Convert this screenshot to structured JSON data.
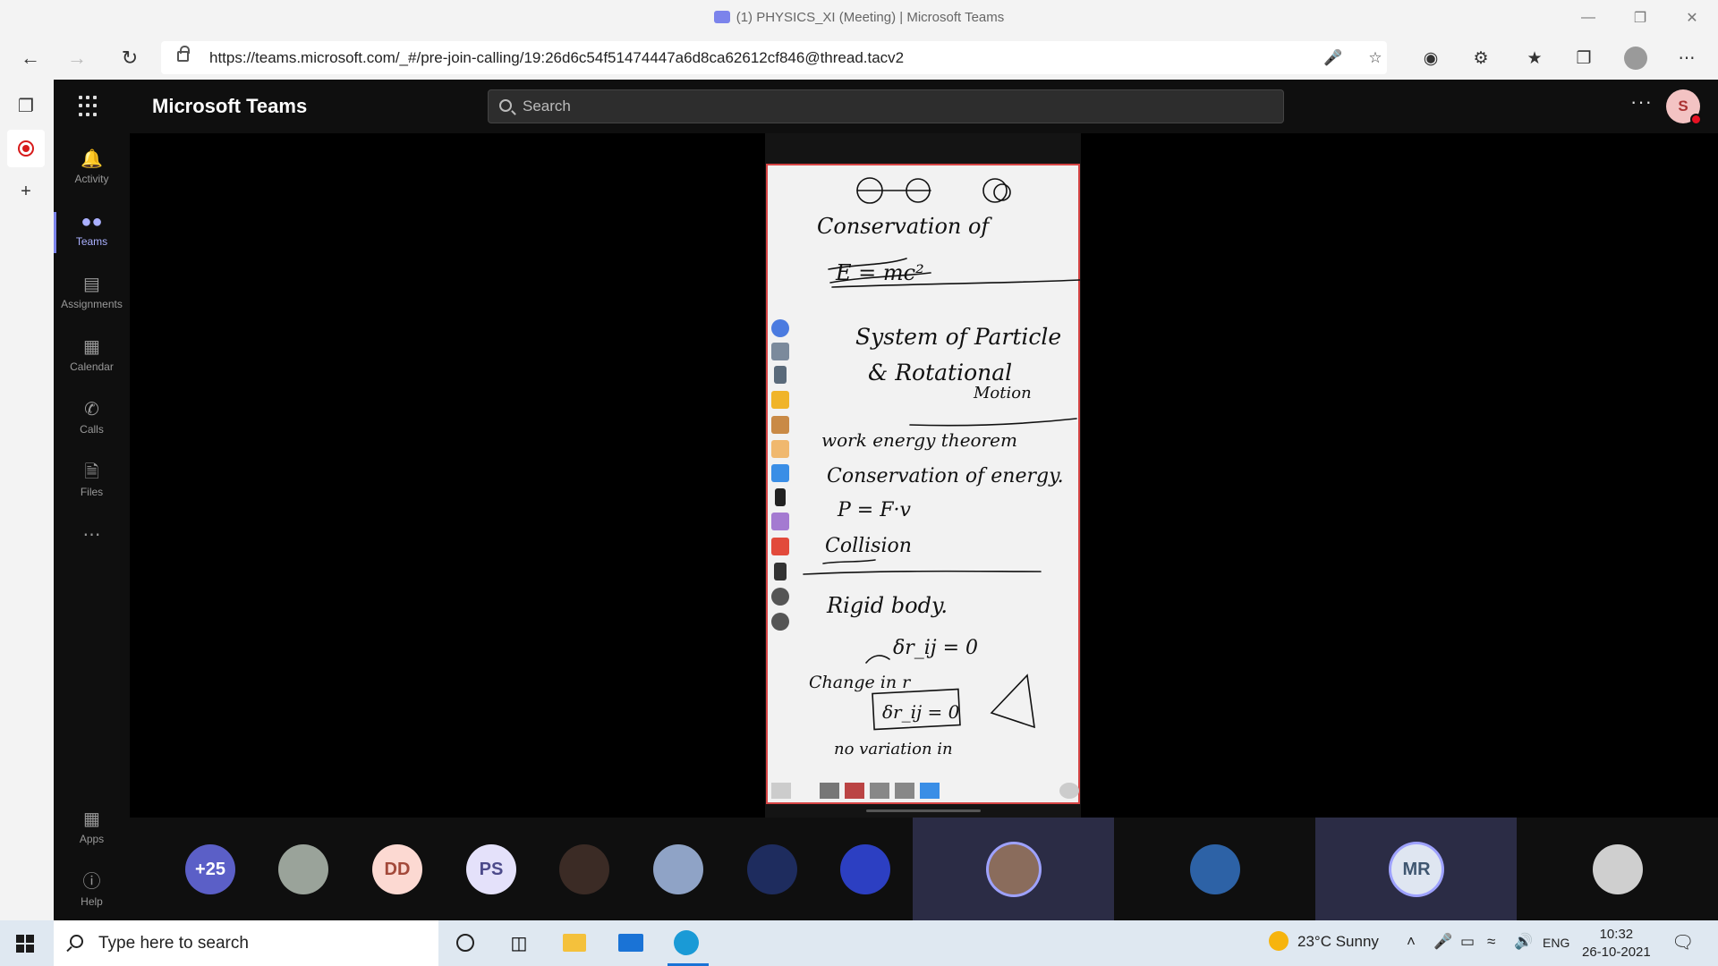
{
  "browser": {
    "window_title": "(1) PHYSICS_XI (Meeting) | Microsoft Teams",
    "url": "https://teams.microsoft.com/_#/pre-join-calling/19:26d6c54f51474447a6d8ca62612cf846@thread.tacv2"
  },
  "teams": {
    "app_name": "Microsoft Teams",
    "search_placeholder": "Search",
    "user_initial": "S",
    "rail": [
      {
        "label": "Activity",
        "icon": "bell-icon"
      },
      {
        "label": "Teams",
        "icon": "teams-icon"
      },
      {
        "label": "Assignments",
        "icon": "assignments-icon"
      },
      {
        "label": "Calendar",
        "icon": "calendar-icon"
      },
      {
        "label": "Calls",
        "icon": "phone-icon"
      },
      {
        "label": "Files",
        "icon": "file-icon"
      }
    ],
    "rail_bottom": [
      {
        "label": "Apps",
        "icon": "apps-icon"
      },
      {
        "label": "Help",
        "icon": "help-icon"
      }
    ],
    "more_label": "···"
  },
  "participants": [
    {
      "label": "+25",
      "bg": "#5b5fc7",
      "fg": "#ffffff"
    },
    {
      "label": "",
      "kind": "photo",
      "bg": "#9aa39a"
    },
    {
      "label": "DD",
      "bg": "#fcd9d2",
      "fg": "#a3493a"
    },
    {
      "label": "PS",
      "bg": "#e4e1fa",
      "fg": "#4c4a8a"
    },
    {
      "label": "",
      "kind": "photo",
      "bg": "#3b2b25"
    },
    {
      "label": "",
      "kind": "photo",
      "bg": "#8fa3c6"
    },
    {
      "label": "",
      "kind": "photo",
      "bg": "#1e2c5e"
    },
    {
      "label": "",
      "kind": "photo",
      "bg": "#2c3fc2"
    },
    {
      "label": "",
      "kind": "photo",
      "bg": "#8a6c5c"
    },
    {
      "label": "",
      "kind": "photo",
      "bg": "#2d62a6"
    },
    {
      "label": "MR",
      "bg": "#dfe6f1",
      "fg": "#3f5670"
    },
    {
      "label": "",
      "kind": "photo",
      "bg": "#cfcfcf"
    }
  ],
  "taskbar": {
    "search_placeholder": "Type here to search",
    "weather": "23°C  Sunny",
    "language": "ENG",
    "time": "10:32",
    "date": "26-10-2021"
  },
  "whiteboard": {
    "lines": [
      "Conservation of",
      "E = mc²",
      "System of Particle",
      "& Rotational",
      "Motion",
      "work energy theorem",
      "Conservation of energy.",
      "P = F·v",
      "Collision",
      "Rigid body.",
      "δr_ij = 0",
      "Change in r",
      "δr_ij = 0",
      "no variation in"
    ]
  },
  "colors": {
    "accent": "#7b83eb",
    "dark_bg": "#0f0f0f",
    "board_border": "#d64545",
    "record": "#d71a1a"
  }
}
